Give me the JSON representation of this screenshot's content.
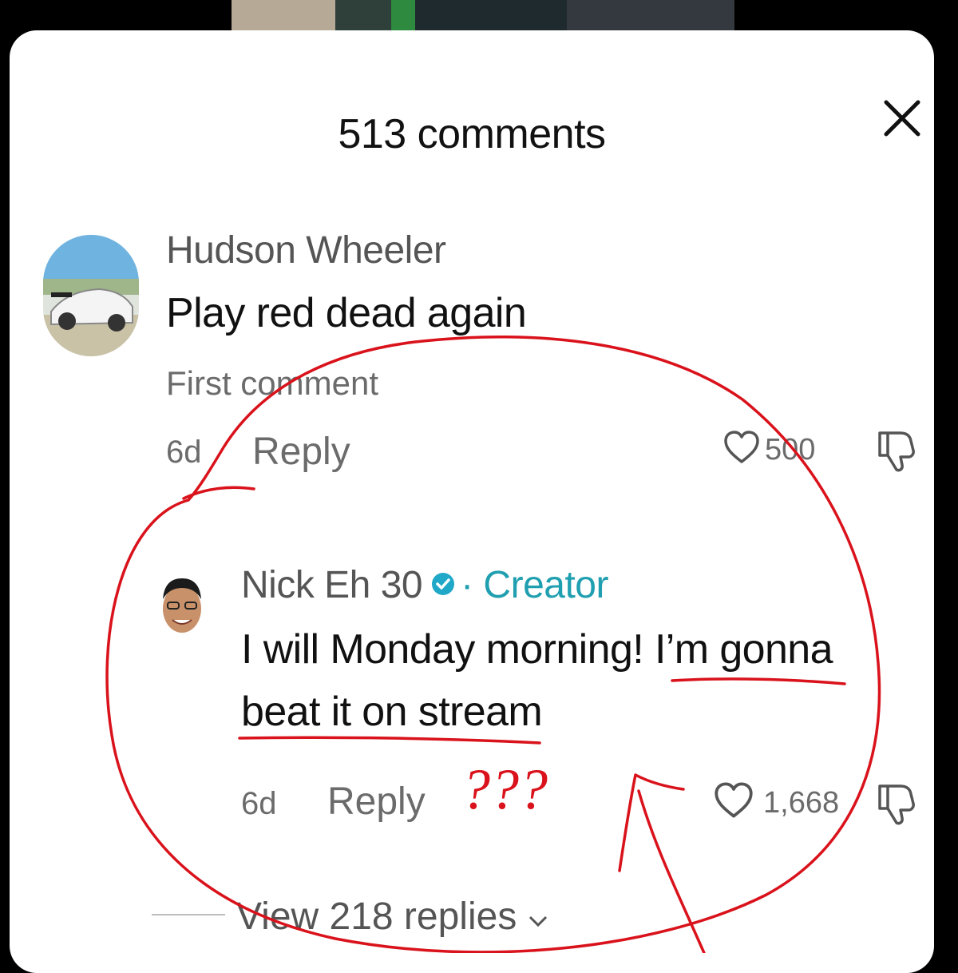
{
  "header": {
    "title": "513 comments"
  },
  "comments": [
    {
      "username": "Hudson Wheeler",
      "text": "Play red dead again",
      "tag": "First comment",
      "time": "6d",
      "reply_label": "Reply",
      "likes": "500"
    },
    {
      "username": "Nick Eh 30",
      "badge": "· Creator",
      "text_line1": "I will Monday morning! I’m gonna",
      "text_line2": "beat it on stream",
      "time": "6d",
      "reply_label": "Reply",
      "likes": "1,668"
    }
  ],
  "view_replies": "View 218 replies",
  "annotation": {
    "text": "???",
    "color": "#d9121b"
  },
  "colors": {
    "accent": "#1f9fb0",
    "annotation": "#d9121b"
  }
}
